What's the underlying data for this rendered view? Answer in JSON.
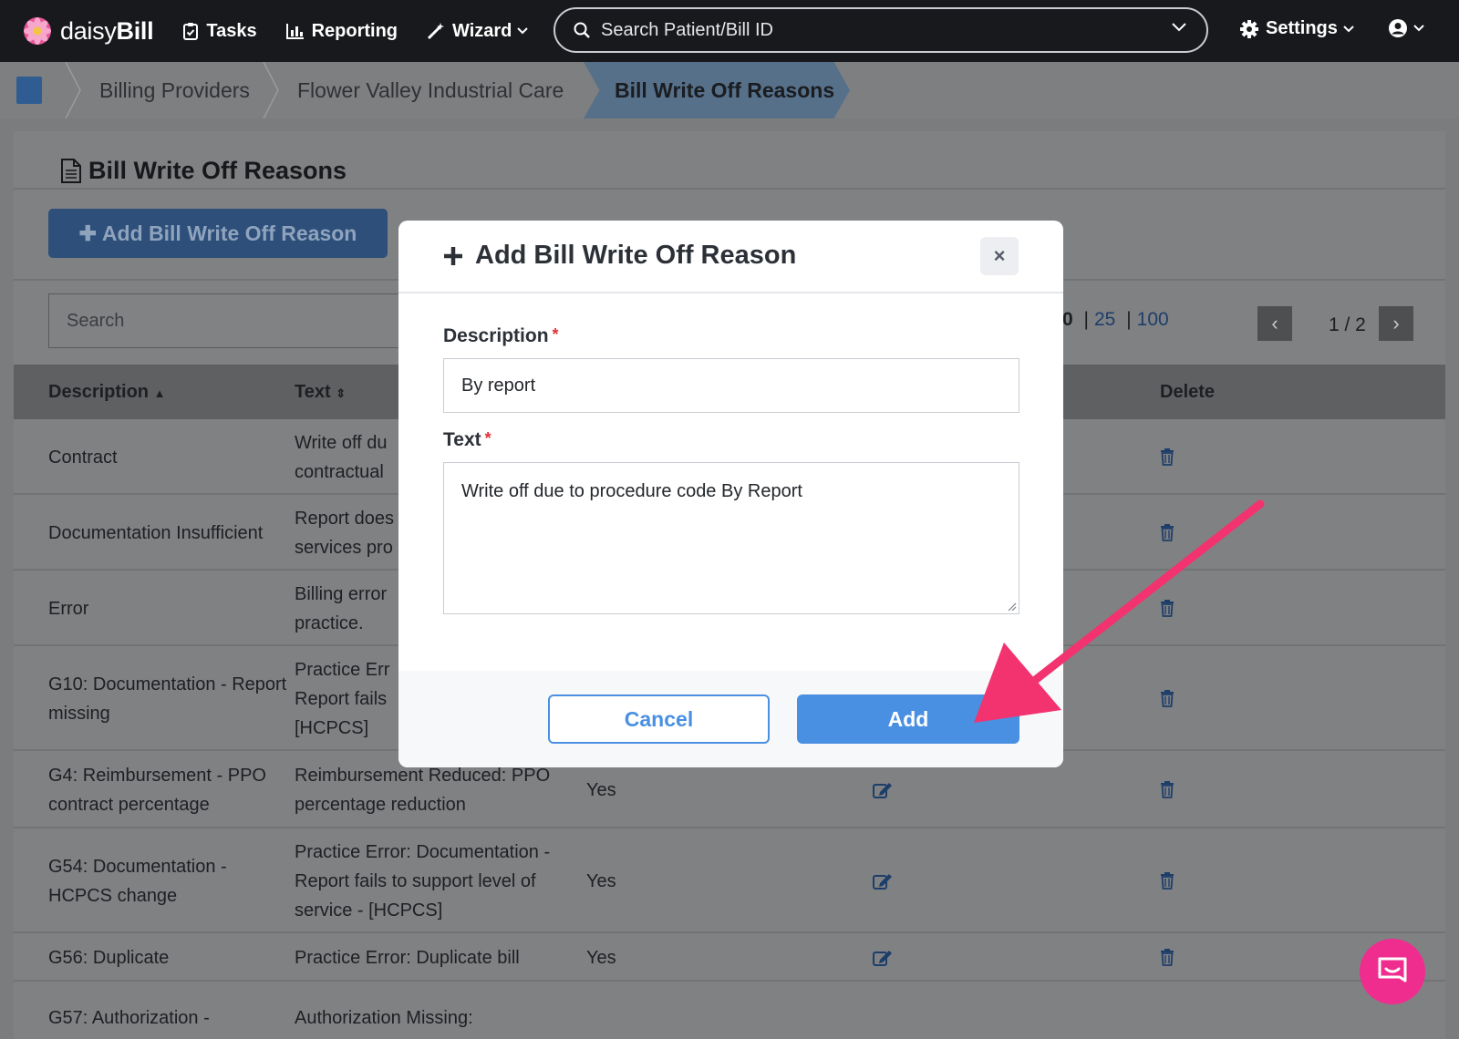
{
  "nav": {
    "logo_prefix": "daisy",
    "logo_suffix": "Bill",
    "tasks": "Tasks",
    "reporting": "Reporting",
    "wizard": "Wizard",
    "search_placeholder": "Search Patient/Bill ID",
    "settings": "Settings"
  },
  "breadcrumb": {
    "items": [
      "Billing Providers",
      "Flower Valley Industrial Care"
    ],
    "active": "Bill Write Off Reasons"
  },
  "page": {
    "title": "Bill Write Off Reasons",
    "add_button": "Add Bill Write Off Reason",
    "search_placeholder": "Search",
    "page_sizes": {
      "current": "0",
      "opt25": "25",
      "opt100": "100"
    },
    "pager_prev": "‹",
    "pager_next": "›",
    "pager_count": "1 / 2",
    "columns": {
      "description": "Description",
      "text": "Text",
      "delete": "Delete"
    },
    "rows": [
      {
        "description": [
          "Contract"
        ],
        "text": [
          "Write off du",
          "contractual"
        ],
        "active": "",
        "has_edit": false
      },
      {
        "description": [
          "Documentation Insufficient"
        ],
        "text": [
          "Report does",
          "services pro"
        ],
        "active": "",
        "has_edit": false
      },
      {
        "description": [
          "Error"
        ],
        "text": [
          "Billing error",
          "practice."
        ],
        "active": "",
        "has_edit": false
      },
      {
        "description": [
          "G10: Documentation - Report",
          "missing"
        ],
        "text": [
          "Practice Err",
          "Report fails",
          "[HCPCS]"
        ],
        "active": "",
        "has_edit": false
      },
      {
        "description": [
          "G4: Reimbursement - PPO",
          "contract percentage"
        ],
        "text": [
          "Reimbursement Reduced: PPO",
          "percentage reduction"
        ],
        "active": "Yes",
        "has_edit": true
      },
      {
        "description": [
          "G54: Documentation -",
          "HCPCS change"
        ],
        "text": [
          "Practice Error: Documentation -",
          "Report fails to support level of",
          "service - [HCPCS]"
        ],
        "active": "Yes",
        "has_edit": true
      },
      {
        "description": [
          "G56: Duplicate"
        ],
        "text": [
          "Practice Error: Duplicate bill"
        ],
        "active": "Yes",
        "has_edit": true
      },
      {
        "description": [
          "G57: Authorization -"
        ],
        "text": [
          "Authorization Missing:"
        ],
        "active": "",
        "has_edit": false
      }
    ]
  },
  "modal": {
    "title": "Add Bill Write Off Reason",
    "close": "×",
    "description_label": "Description",
    "description_value": "By report",
    "text_label": "Text",
    "text_value": "Write off due to procedure code By Report",
    "required_mark": "*",
    "cancel": "Cancel",
    "add": "Add"
  },
  "colors": {
    "accent": "#4a90e2",
    "required": "#e0313a",
    "annotation_arrow": "#f2336f",
    "chat": "#ef2d8f",
    "nav_bg": "#18191c"
  }
}
